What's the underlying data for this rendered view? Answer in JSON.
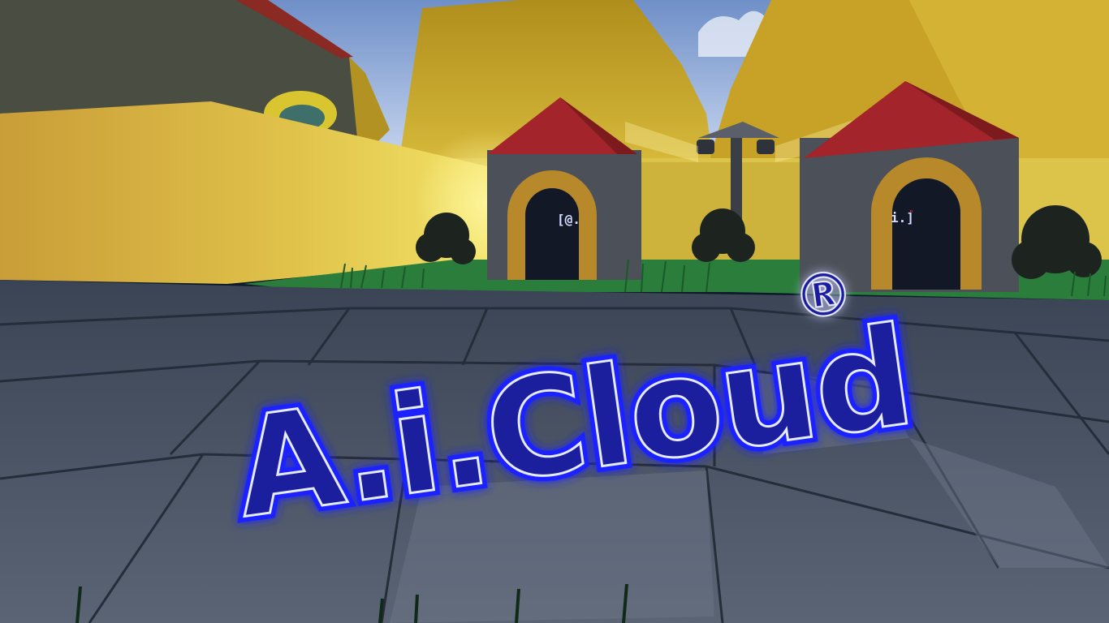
{
  "scene": {
    "logo_text": "A.i.Cloud",
    "logo_mark": "®",
    "left_door_sign": "[@.",
    "right_door_sign": "i.]",
    "right_door_sign_dot": "\"",
    "colors": {
      "sky": "#9ab8e6",
      "cliffs": "#c9a528",
      "wall": "#d6b23a",
      "grass": "#2a7a3a",
      "stone_floor": "#4a5568",
      "house_stone": "#4b4f58",
      "roof": "#a3242a",
      "door_arch": "#b48a24",
      "logo_glow": "#1a22ff",
      "logo_face": "#dfe6ff"
    }
  }
}
